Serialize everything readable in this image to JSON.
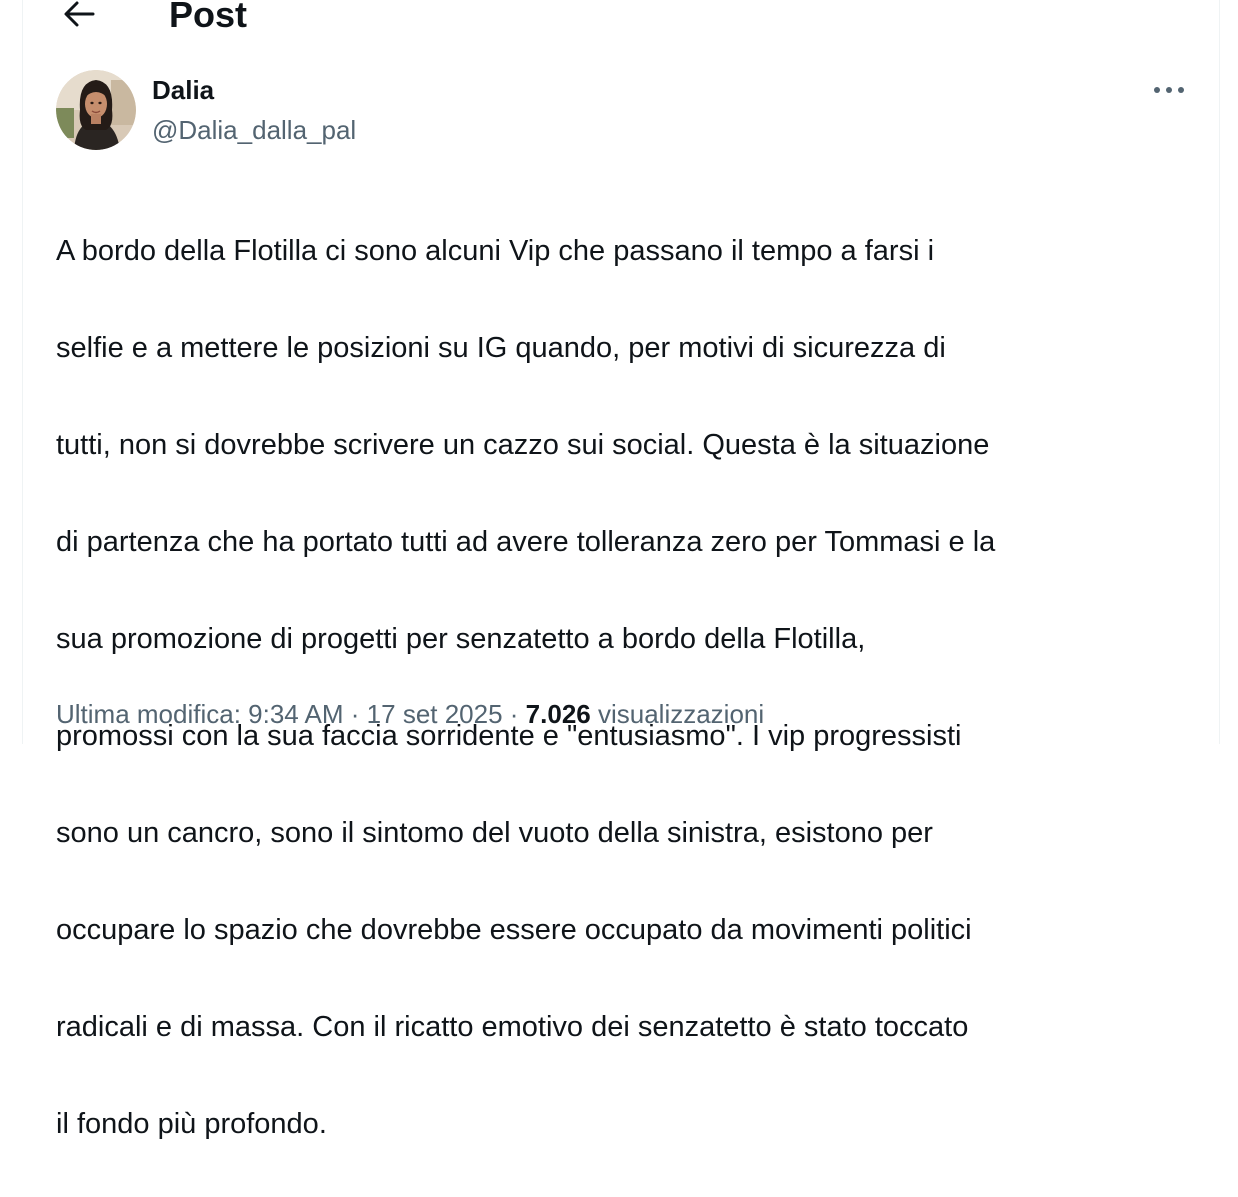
{
  "header": {
    "title": "Post",
    "back_icon": "arrow-left-icon"
  },
  "author": {
    "name": "Dalia",
    "handle": "@Dalia_dalla_pal",
    "avatar_icon": "avatar-photo"
  },
  "more_icon": "more-horizontal-icon",
  "post": {
    "lines": [
      "A bordo della Flotilla ci sono alcuni   Vip  che passano il tempo a farsi i",
      "selfie e a mettere le posizioni su IG quando, per motivi di sicurezza di",
      "tutti, non si dovrebbe scrivere un cazzo sui social. Questa è la situazione",
      "di partenza che ha portato tutti ad avere tolleranza zero per Tommasi e la",
      "sua promozione di progetti per senzatetto a bordo della Flotilla,",
      "promossi con la sua faccia sorridente e \"entusiasmo\". I vip progressisti",
      "sono un cancro, sono il sintomo del vuoto della sinistra, esistono per",
      "occupare lo spazio che dovrebbe essere occupato da movimenti politici",
      "radicali e di massa. Con il ricatto emotivo dei senzatetto è stato toccato",
      "il fondo più profondo."
    ]
  },
  "meta": {
    "edited": "Ultima modifica: 9:34 AM",
    "sep1": " · ",
    "date": "17 set 2025",
    "sep2": " · ",
    "views_count": "7.026",
    "views_label": " visualizzazioni"
  },
  "colors": {
    "text": "#0f1419",
    "secondary": "#536471",
    "border": "#eff3f4"
  }
}
